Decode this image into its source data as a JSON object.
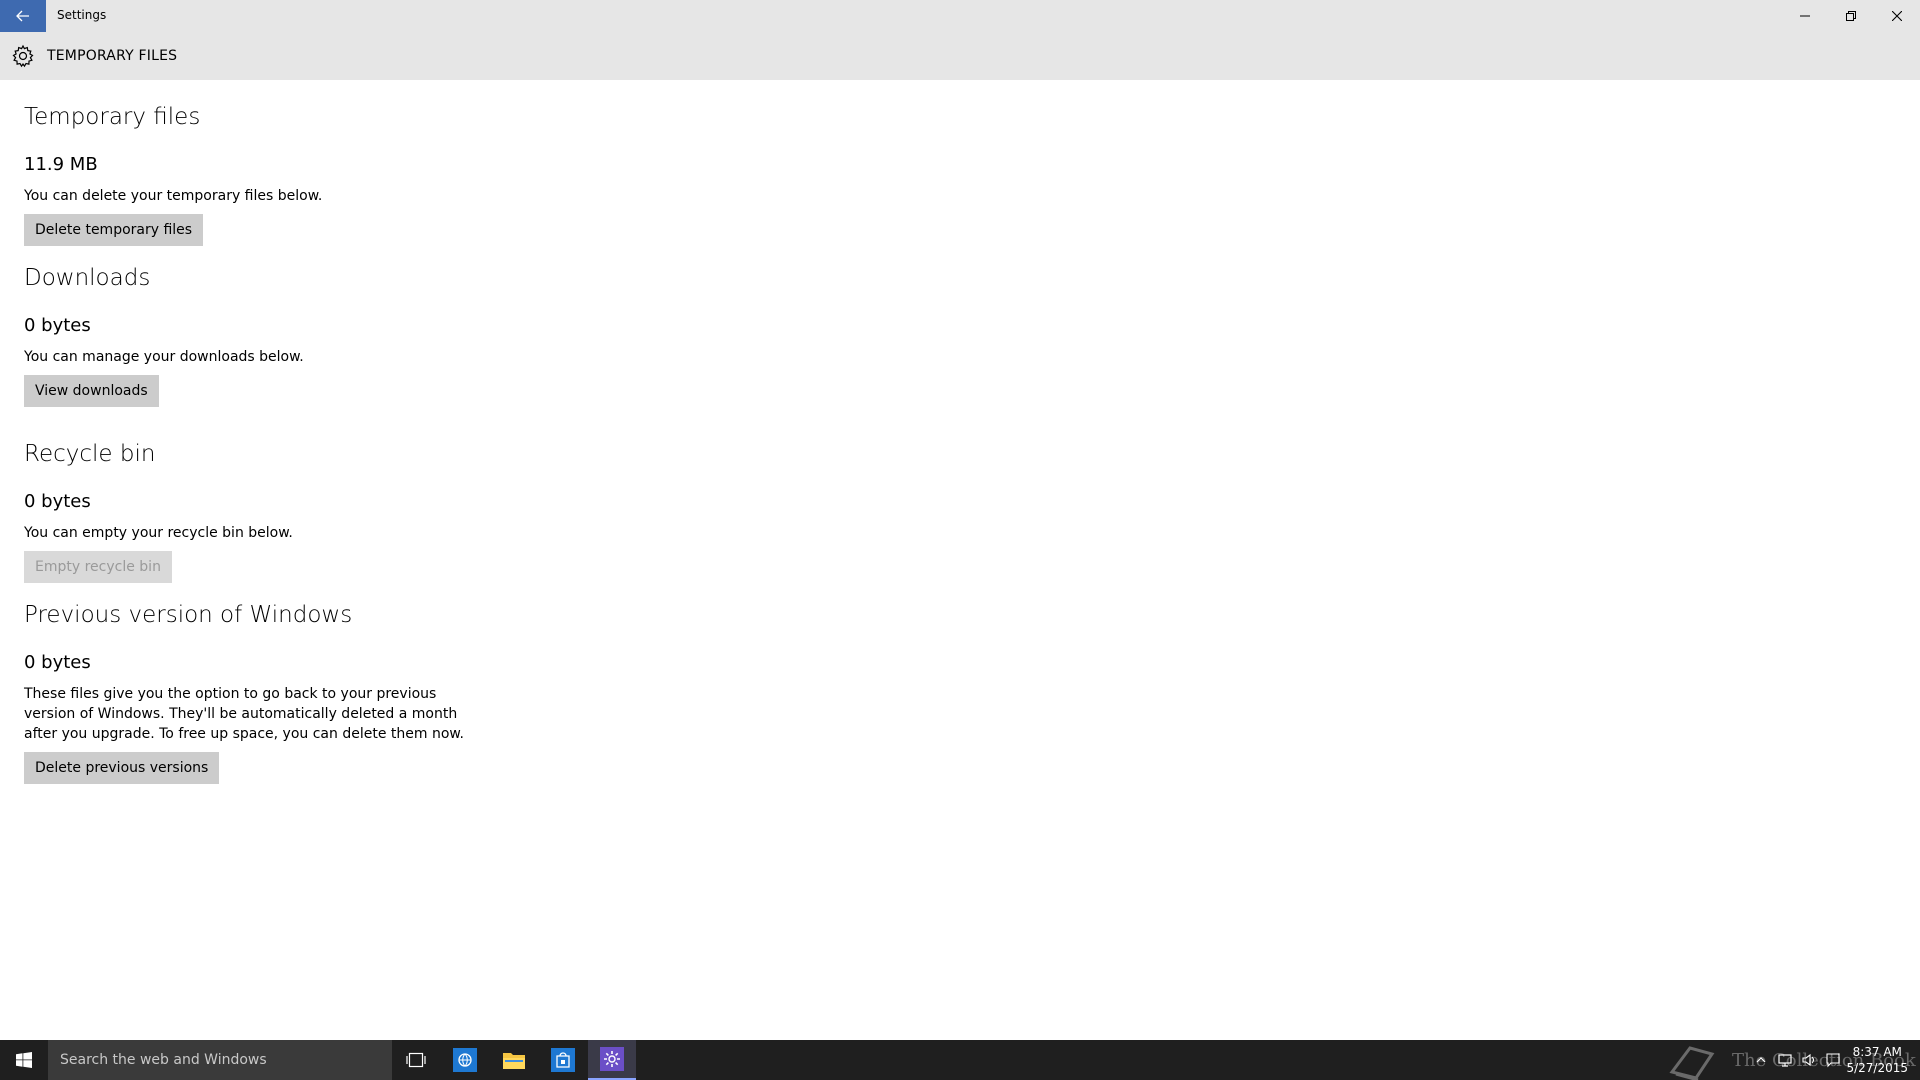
{
  "window": {
    "title": "Settings"
  },
  "header": {
    "title": "TEMPORARY FILES"
  },
  "sections": [
    {
      "title": "Temporary files",
      "size": "11.9 MB",
      "description": "You can delete your temporary files below.",
      "button": "Delete temporary files",
      "button_enabled": true
    },
    {
      "title": "Downloads",
      "size": "0 bytes",
      "description": "You can manage your downloads below.",
      "button": "View downloads",
      "button_enabled": true
    },
    {
      "title": "Recycle bin",
      "size": "0 bytes",
      "description": "You can empty your recycle bin below.",
      "button": "Empty recycle bin",
      "button_enabled": false
    },
    {
      "title": "Previous version of Windows",
      "size": "0 bytes",
      "description": "These files give you the option to go back to your previous version of Windows. They'll be automatically deleted a month after you upgrade. To free up space, you can delete them now.",
      "button": "Delete previous versions",
      "button_enabled": true
    }
  ],
  "taskbar": {
    "search_placeholder": "Search the web and Windows",
    "apps": [
      "task-view-icon",
      "edge-icon",
      "file-explorer-icon",
      "store-icon",
      "settings-icon"
    ],
    "watermark": "The Collection Book",
    "time": "8:37 AM",
    "date": "5/27/2015"
  },
  "colors": {
    "accent": "#3e6ab0",
    "titlebar": "#e6e6e6",
    "button": "#cccccc",
    "taskbar": "#1f1f1f"
  }
}
